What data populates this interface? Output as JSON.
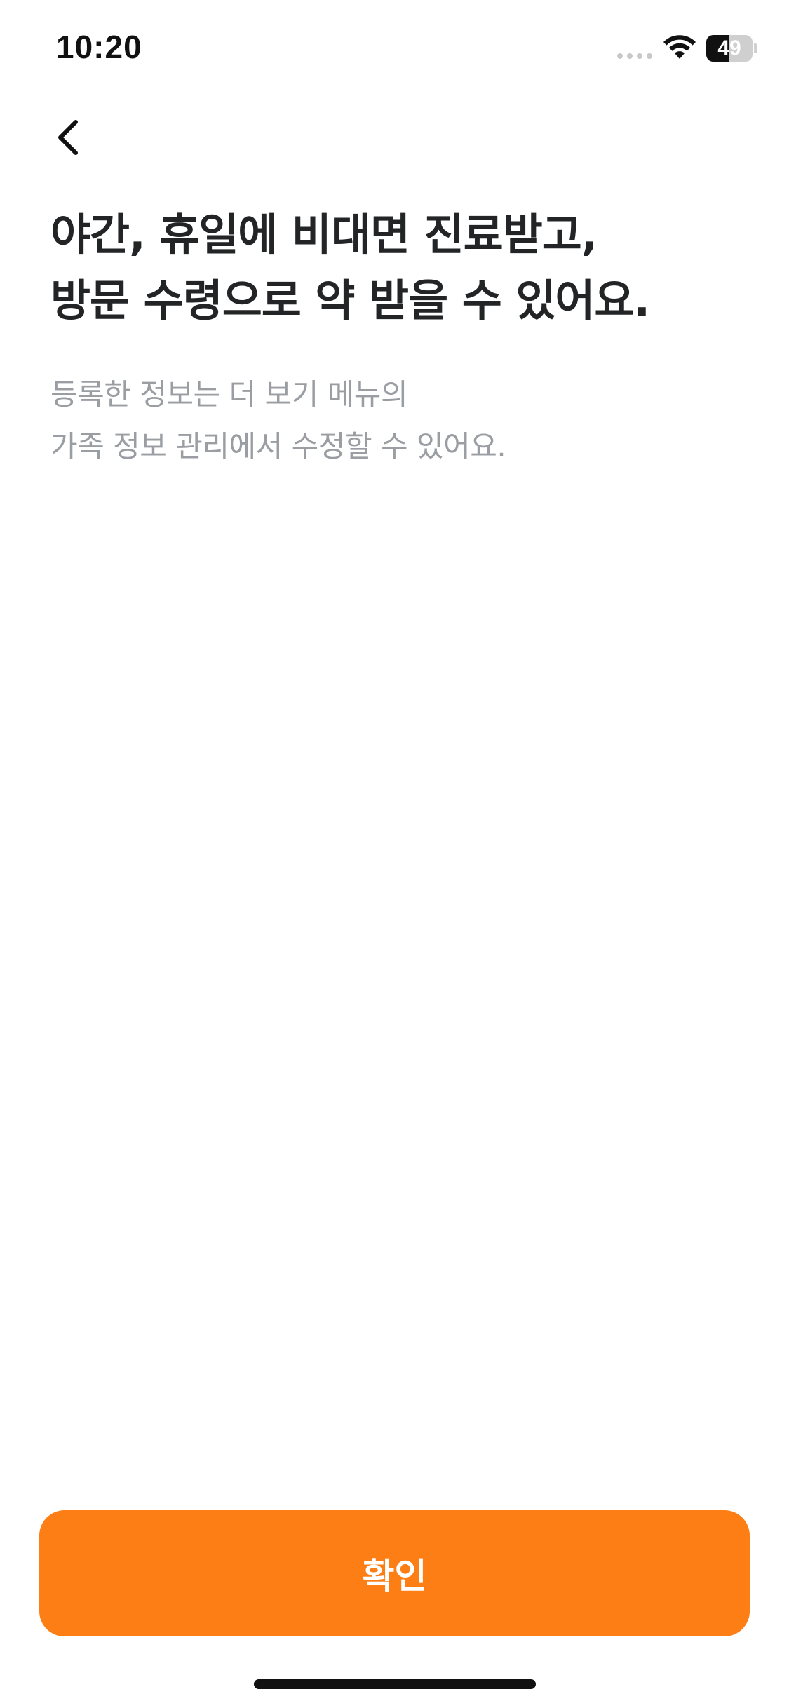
{
  "status_bar": {
    "time": "10:20",
    "battery_level": "49",
    "battery_fraction": 0.49
  },
  "navigation": {
    "back_icon": "chevron-left-icon"
  },
  "content": {
    "headline_lines": [
      "야간, 휴일에 비대면 진료받고,",
      "방문 수령으로 약 받을 수 있어요."
    ],
    "description_lines": [
      "등록한 정보는 더 보기 메뉴의",
      "가족 정보 관리에서 수정할 수 있어요."
    ]
  },
  "confirm_button": {
    "label": "확인"
  },
  "colors": {
    "accent": "#fd7e14",
    "headline": "#222426",
    "description": "#9a9ea3"
  }
}
